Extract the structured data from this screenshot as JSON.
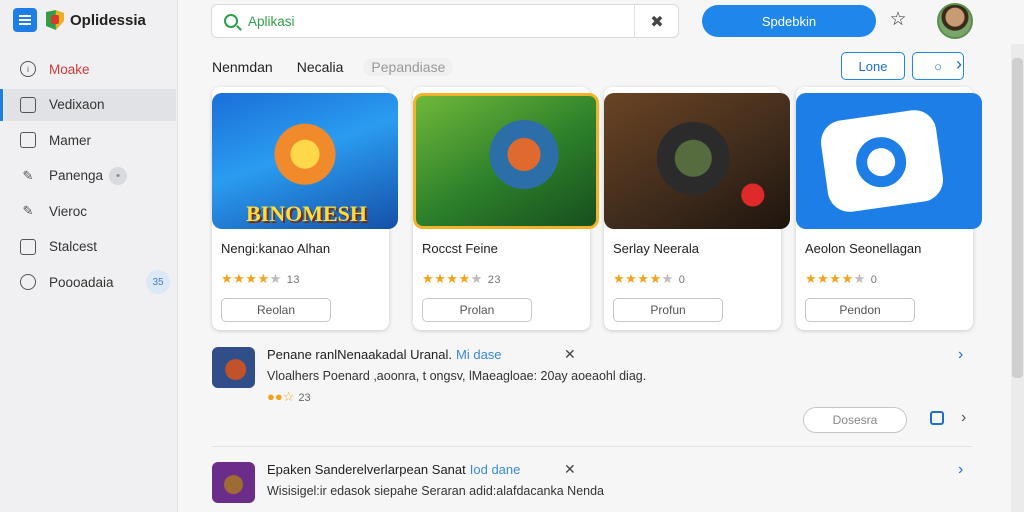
{
  "app": {
    "name": "Oplidessia"
  },
  "search": {
    "placeholder": "Aplikasi"
  },
  "header": {
    "primary_button": "Spdebkin"
  },
  "sidebar": {
    "items": [
      {
        "label": "Moake",
        "icon": "info-icon"
      },
      {
        "label": "Vedixaon",
        "icon": "window-icon"
      },
      {
        "label": "Mamer",
        "icon": "box-icon"
      },
      {
        "label": "Panenga",
        "icon": "chat-icon"
      },
      {
        "label": "Vieroc",
        "icon": "edit-icon"
      },
      {
        "label": "Stalcest",
        "icon": "chat-icon"
      },
      {
        "label": "Poooadaia",
        "icon": "chat-icon",
        "badge": "35"
      }
    ]
  },
  "tabs": [
    {
      "label": "Nenmdan"
    },
    {
      "label": "Necalia"
    },
    {
      "label": "Pepandiase"
    }
  ],
  "toolbar": {
    "home_label": "Lone"
  },
  "cards": [
    {
      "title": "Nengi:kanao Alhan",
      "rating": 4,
      "count": "13",
      "button": "Reolan",
      "logo_text": "BINOMESH"
    },
    {
      "title": "Roccst Feine",
      "rating": 4,
      "count": "23",
      "button": "Prolan"
    },
    {
      "title": "Serlay Neerala",
      "rating": 4,
      "count": "0",
      "button": "Profun"
    },
    {
      "title": "Aeolon Seonellagan",
      "rating": 4,
      "count": "0",
      "button": "Pendon"
    }
  ],
  "list": [
    {
      "title": "Penane ranlNenaakadal Uranal.",
      "subtitle": "Mi dase",
      "description": "Vloalhers Poenard ,aoonra, t ongsv, lMaeagloae: 20ay aoeaohl diag.",
      "count": "23",
      "button": "Dosesra"
    },
    {
      "title": "Epaken Sanderelverlarpean Sanat",
      "subtitle": "Iod dane",
      "description": "Wisisigel:ir edasok siepahe Seraran adid:alafdacanka Nenda"
    }
  ],
  "colors": {
    "accent": "#1f86ea",
    "brand_green": "#2e9e4a",
    "star": "#f2a31b",
    "danger": "#d33a3a"
  }
}
